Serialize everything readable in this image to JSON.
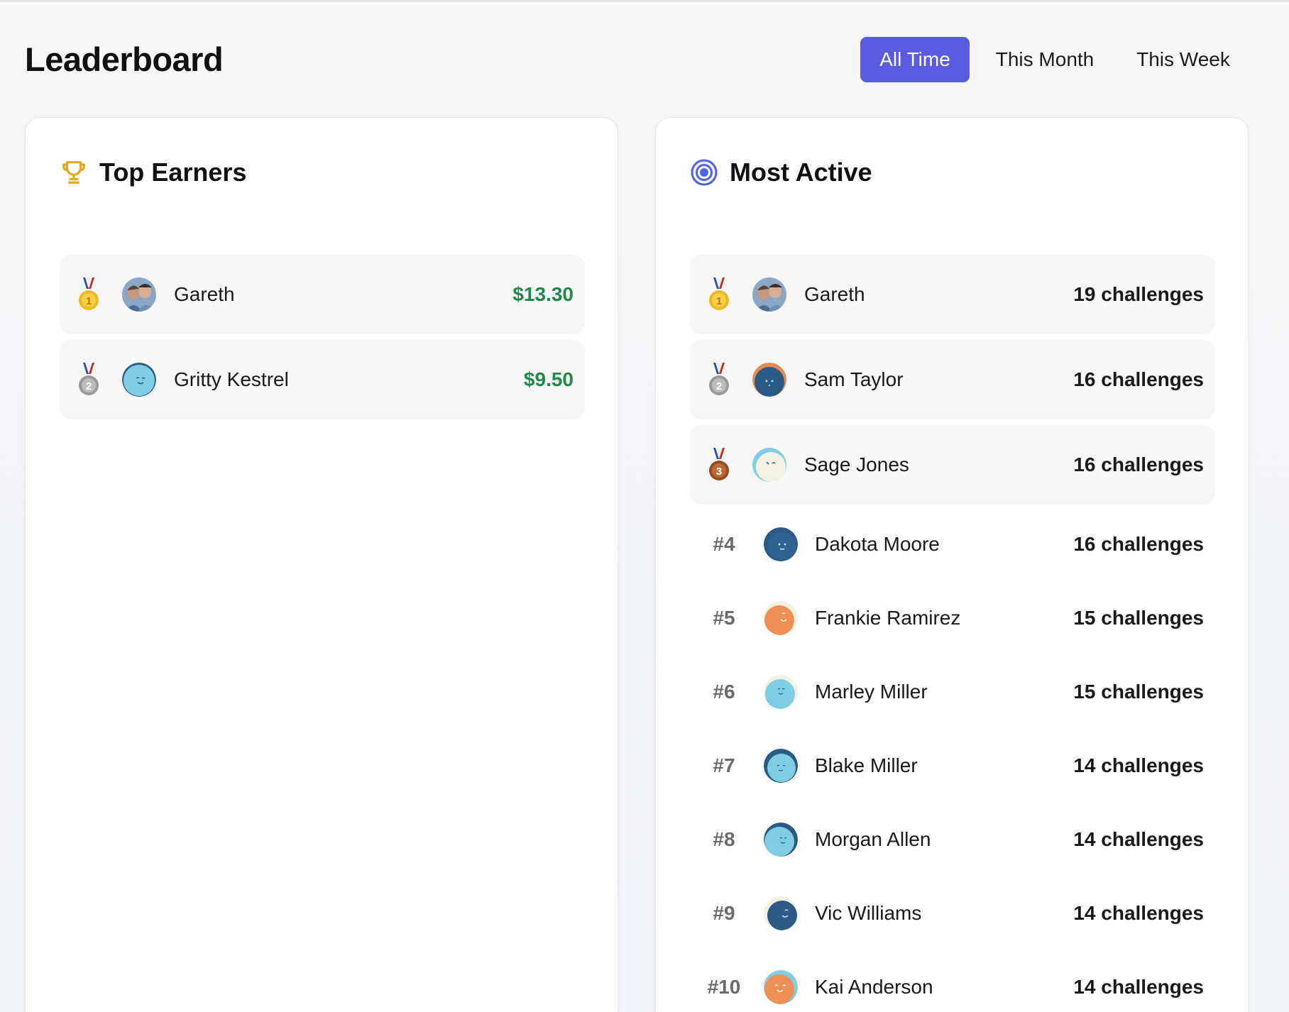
{
  "page": {
    "title": "Leaderboard"
  },
  "filters": {
    "options": [
      "All Time",
      "This Month",
      "This Week"
    ],
    "active": "All Time",
    "accent_color": "#5b5bdf"
  },
  "top_earners": {
    "title": "Top Earners",
    "icon": "trophy-icon",
    "icon_color": "#e7a81a",
    "entries": [
      {
        "medal": "gold-medal-icon",
        "medal_number": "1",
        "avatar": "photo-avatar",
        "name": "Gareth",
        "value": "$13.30"
      },
      {
        "medal": "silver-medal-icon",
        "medal_number": "2",
        "avatar": "lightblue-avatar",
        "name": "Gritty Kestrel",
        "value": "$9.50"
      }
    ],
    "value_color": "#22894a"
  },
  "most_active": {
    "title": "Most Active",
    "icon": "target-icon",
    "icon_color": "#4f63e6",
    "podium": [
      {
        "medal": "gold-medal-icon",
        "medal_number": "1",
        "avatar": "photo-avatar",
        "name": "Gareth",
        "value": "19 challenges"
      },
      {
        "medal": "silver-medal-icon",
        "medal_number": "2",
        "avatar": "darkblue-orange-avatar",
        "name": "Sam Taylor",
        "value": "16 challenges"
      },
      {
        "medal": "bronze-medal-icon",
        "medal_number": "3",
        "avatar": "cream-avatar",
        "name": "Sage Jones",
        "value": "16 challenges"
      }
    ],
    "others": [
      {
        "rank": "#4",
        "avatar": "darkblue-avatar",
        "name": "Dakota Moore",
        "value": "16 challenges"
      },
      {
        "rank": "#5",
        "avatar": "orange-avatar",
        "name": "Frankie Ramirez",
        "value": "15 challenges"
      },
      {
        "rank": "#6",
        "avatar": "lightblue-avatar",
        "name": "Marley Miller",
        "value": "15 challenges"
      },
      {
        "rank": "#7",
        "avatar": "lightblue-avatar",
        "name": "Blake Miller",
        "value": "14 challenges"
      },
      {
        "rank": "#8",
        "avatar": "lightblue-avatar",
        "name": "Morgan Allen",
        "value": "14 challenges"
      },
      {
        "rank": "#9",
        "avatar": "darkblue-avatar",
        "name": "Vic Williams",
        "value": "14 challenges"
      },
      {
        "rank": "#10",
        "avatar": "orange-avatar",
        "name": "Kai Anderson",
        "value": "14 challenges"
      }
    ]
  }
}
